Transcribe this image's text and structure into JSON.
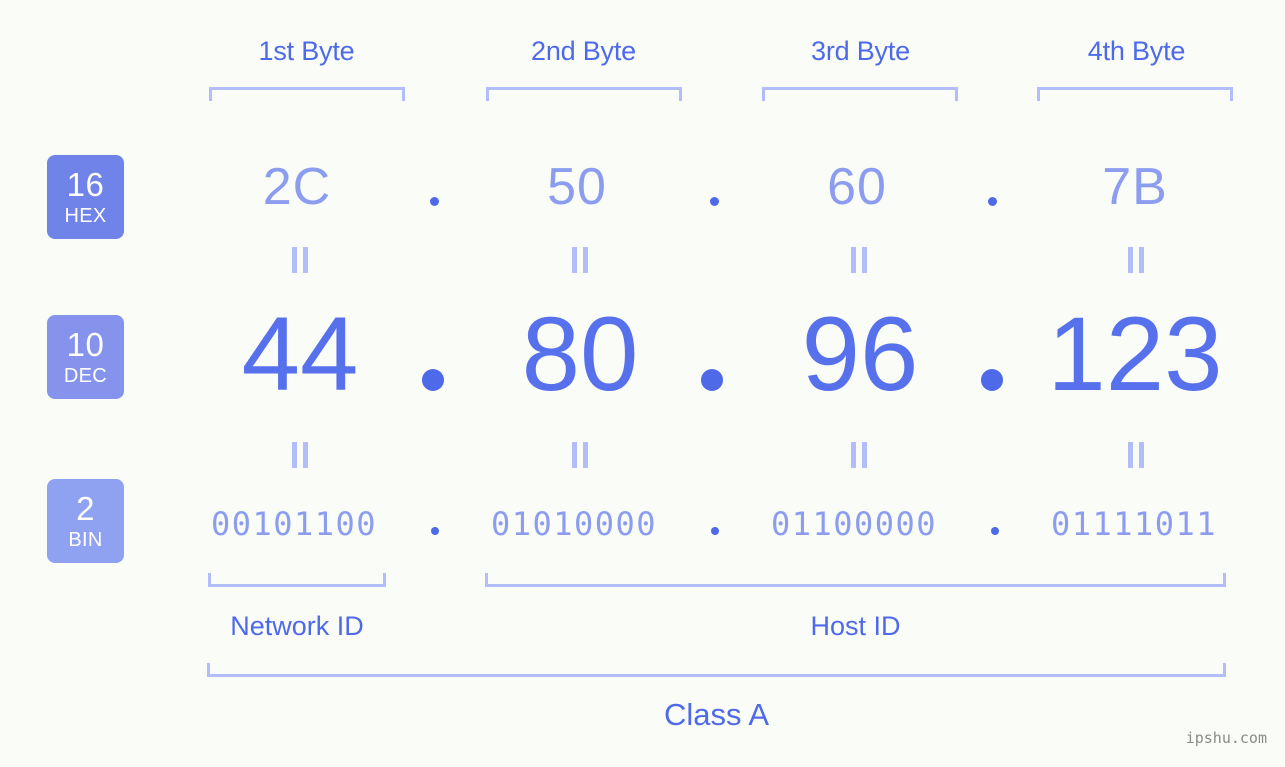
{
  "header": {
    "byte_labels": [
      "1st Byte",
      "2nd Byte",
      "3rd Byte",
      "4th Byte"
    ]
  },
  "bases": [
    {
      "number": "16",
      "name": "HEX",
      "color": "#7083e8"
    },
    {
      "number": "10",
      "name": "DEC",
      "color": "#8593ed"
    },
    {
      "number": "2",
      "name": "BIN",
      "color": "#8fa2f2"
    }
  ],
  "rows": {
    "hex": {
      "octets": [
        "2C",
        "50",
        "60",
        "7B"
      ],
      "separator": "."
    },
    "dec": {
      "octets": [
        "44",
        "80",
        "96",
        "123"
      ],
      "separator": "."
    },
    "bin": {
      "octets": [
        "00101100",
        "01010000",
        "01100000",
        "01111011"
      ],
      "separator": "."
    }
  },
  "equals_symbol": "=",
  "sections": {
    "network_id": "Network ID",
    "host_id": "Host ID",
    "class": "Class A"
  },
  "watermark": "ipshu.com",
  "colors": {
    "background": "#fafcf8",
    "accent_strong": "#4f6ae8",
    "accent_mid": "#5771ec",
    "accent_light": "#8c9df0",
    "bracket": "#b3bdfa"
  }
}
